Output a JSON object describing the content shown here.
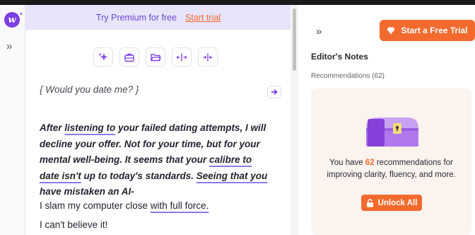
{
  "brand": {
    "logo_letter": "w",
    "accent": "#7c3fe4",
    "cta_color": "#f26a2e"
  },
  "premium_banner": {
    "text": "Try Premium for free",
    "link": "Start trial"
  },
  "toolbar": {
    "icons": [
      "sparkle-icon",
      "briefcase-icon",
      "folder-icon",
      "expand-icon",
      "shrink-icon"
    ]
  },
  "editor": {
    "prompt": "{ Would you date me? }",
    "paragraph": {
      "p1": "After ",
      "u1": "listening to",
      "p2": " your failed dating attempts, I will decline your offer. Not for your time, but for your mental well-being. It seems that your ",
      "u2": "calibre to date isn't",
      "p3": " up to today's standards. ",
      "u3": "Seeing that you",
      "p4": " have mistaken an AI-"
    },
    "line2": {
      "pre": "I slam my computer close ",
      "underlined": "with full force."
    },
    "line3": "I can't believe it!"
  },
  "right_panel": {
    "trial_button": "Start a Free Trial",
    "notes_title": "Editor's Notes",
    "recommendations_label": "Recommendations (62)",
    "card": {
      "text_pre": "You have ",
      "count": "62",
      "text_post": " recommendations for improving clarity, fluency, and more.",
      "button": "Unlock All"
    }
  }
}
